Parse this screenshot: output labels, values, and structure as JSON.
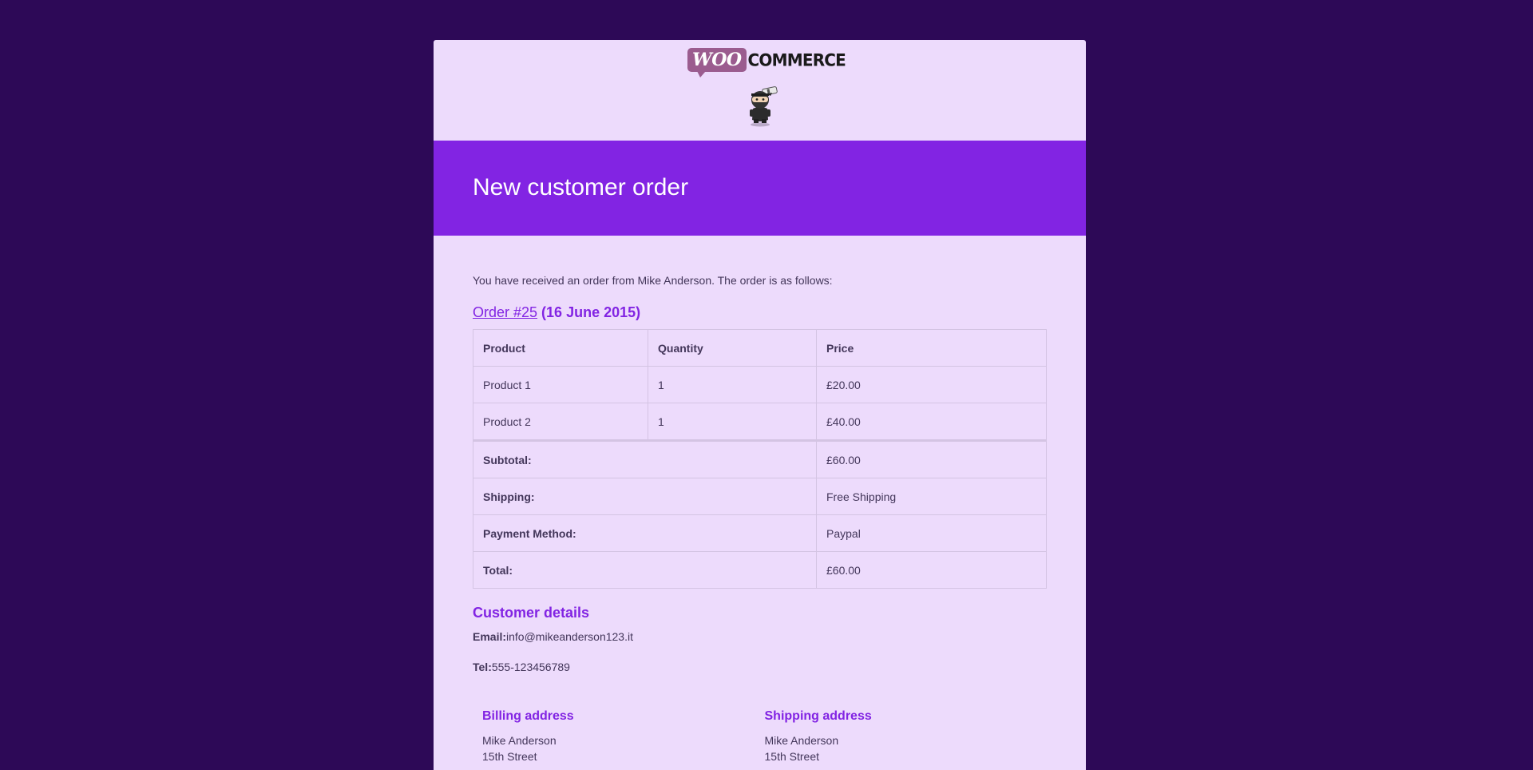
{
  "colors": {
    "background": "#2d0957",
    "card": "#eddbfc",
    "accent": "#8224e3",
    "text": "#43365a",
    "logo_bubble": "#9b5c8f"
  },
  "header": {
    "logo_woo": "WOO",
    "logo_commerce": "COMMERCE",
    "mascot_icon": "ninja-mascot-icon"
  },
  "banner": {
    "title": "New customer order"
  },
  "body": {
    "intro": "You have received an order from Mike Anderson. The order is as follows:",
    "order": {
      "link_text": "Order #25",
      "date_text": " (16 June 2015)"
    },
    "table": {
      "headers": [
        "Product",
        "Quantity",
        "Price"
      ],
      "items": [
        {
          "product": "Product 1",
          "quantity": "1",
          "price": "£20.00"
        },
        {
          "product": "Product 2",
          "quantity": "1",
          "price": "£40.00"
        }
      ],
      "totals": [
        {
          "label": "Subtotal:",
          "value": "£60.00"
        },
        {
          "label": "Shipping:",
          "value": "Free Shipping"
        },
        {
          "label": "Payment Method:",
          "value": "Paypal"
        },
        {
          "label": "Total:",
          "value": "£60.00"
        }
      ]
    },
    "customer": {
      "heading": "Customer details",
      "email_label": "Email:",
      "email_value": "info@mikeanderson123.it",
      "tel_label": "Tel:",
      "tel_value": "555-123456789"
    },
    "billing": {
      "heading": "Billing address",
      "lines": [
        "Mike Anderson",
        "15th Street"
      ]
    },
    "shipping": {
      "heading": "Shipping address",
      "lines": [
        "Mike Anderson",
        "15th Street"
      ]
    }
  }
}
